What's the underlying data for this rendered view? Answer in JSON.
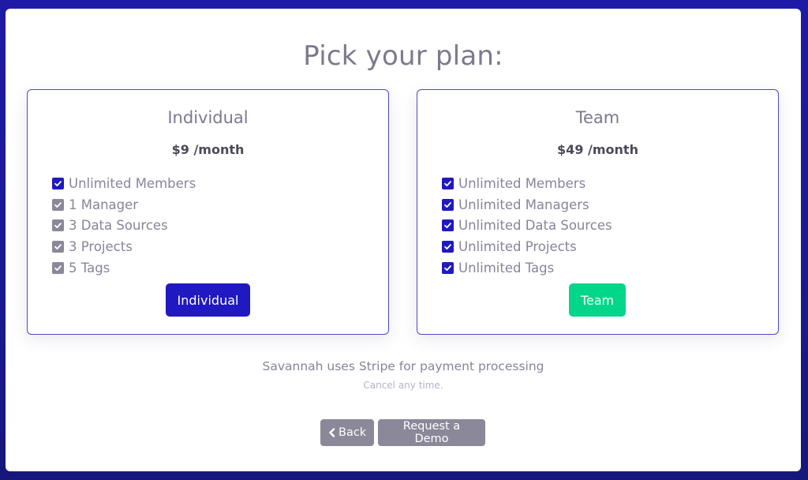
{
  "page": {
    "title": "Pick your plan:"
  },
  "colors": {
    "frame": "#1e1aa6",
    "accent": "#2019c2",
    "success": "#02d68a",
    "muted": "#8a8899"
  },
  "plans": [
    {
      "name": "Individual",
      "price": "$9 /month",
      "button_label": "Individual",
      "features": [
        {
          "label": "Unlimited Members",
          "checked": true,
          "highlighted": true
        },
        {
          "label": "1 Manager",
          "checked": true,
          "highlighted": false
        },
        {
          "label": "3 Data Sources",
          "checked": true,
          "highlighted": false
        },
        {
          "label": "3 Projects",
          "checked": true,
          "highlighted": false
        },
        {
          "label": "5 Tags",
          "checked": true,
          "highlighted": false
        }
      ]
    },
    {
      "name": "Team",
      "price": "$49 /month",
      "button_label": "Team",
      "features": [
        {
          "label": "Unlimited Members",
          "checked": true,
          "highlighted": true
        },
        {
          "label": "Unlimited Managers",
          "checked": true,
          "highlighted": true
        },
        {
          "label": "Unlimited Data Sources",
          "checked": true,
          "highlighted": true
        },
        {
          "label": "Unlimited Projects",
          "checked": true,
          "highlighted": true
        },
        {
          "label": "Unlimited Tags",
          "checked": true,
          "highlighted": true
        }
      ]
    }
  ],
  "notes": {
    "stripe": "Savannah uses Stripe for payment processing",
    "cancel": "Cancel any time."
  },
  "footer": {
    "back_label": "Back",
    "back_icon": "chevron-left-icon",
    "demo_label": "Request a Demo"
  }
}
